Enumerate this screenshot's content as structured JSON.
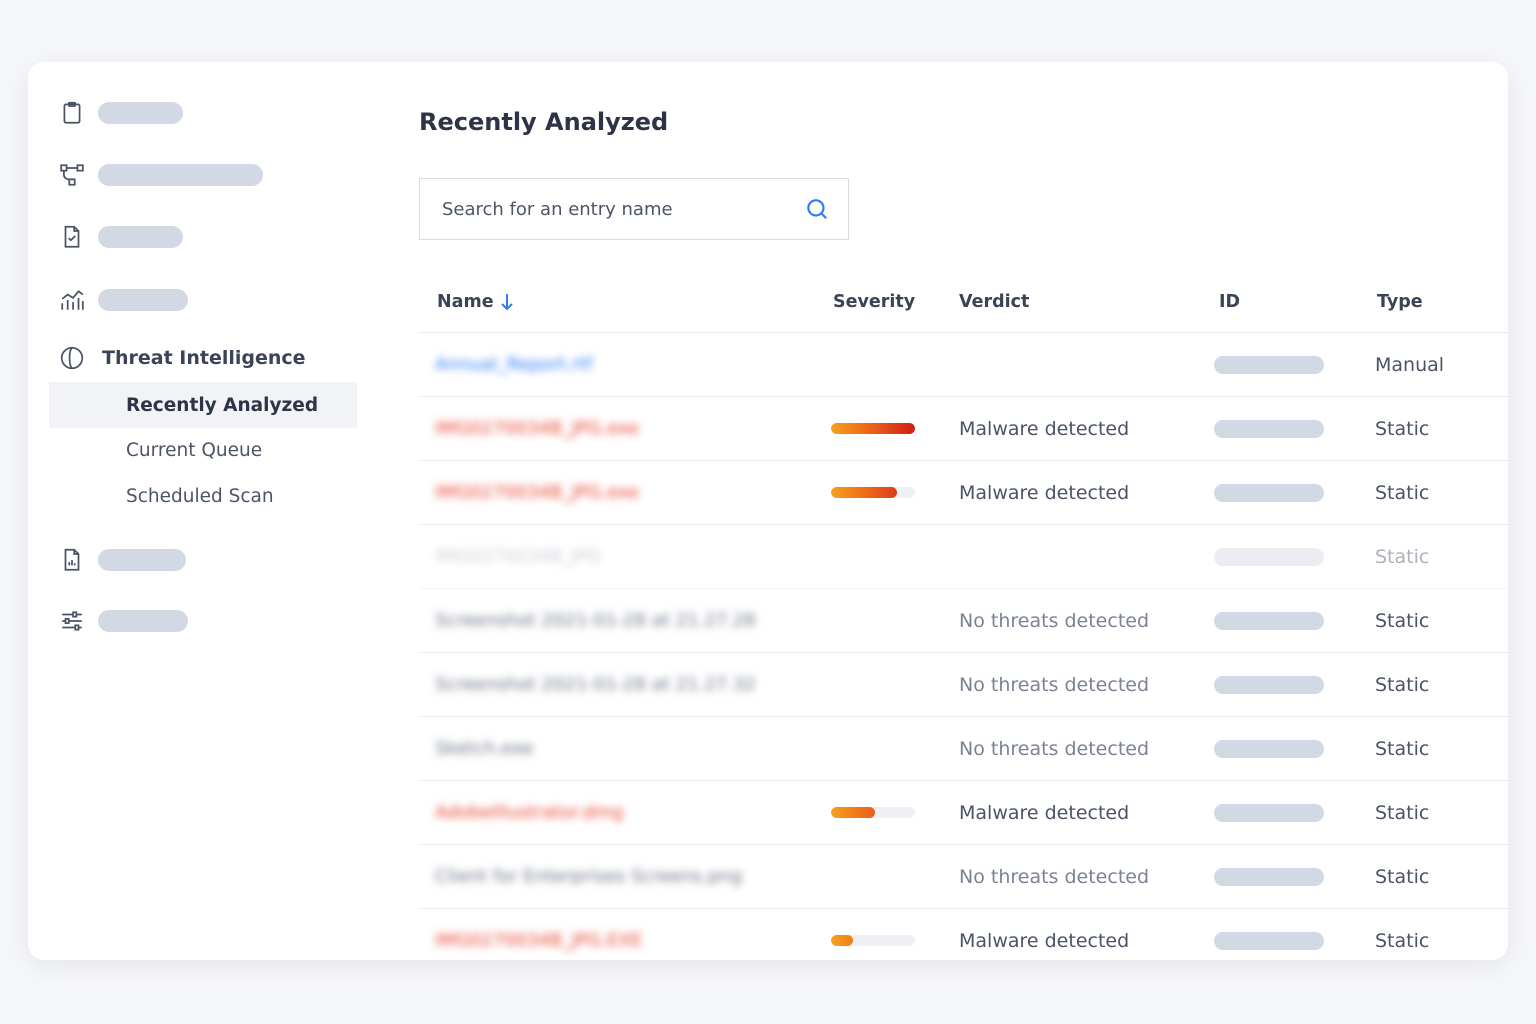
{
  "sidebar": {
    "items": [
      {
        "icon": "clipboard-icon"
      },
      {
        "icon": "workflow-icon"
      },
      {
        "icon": "file-check-icon"
      },
      {
        "icon": "analytics-icon"
      },
      {
        "icon": "threat-intelligence-icon",
        "label": "Threat Intelligence"
      },
      {
        "icon": "file-report-icon"
      },
      {
        "icon": "sliders-icon"
      }
    ],
    "subitems": [
      {
        "label": "Recently Analyzed",
        "active": true
      },
      {
        "label": "Current Queue"
      },
      {
        "label": "Scheduled Scan"
      }
    ]
  },
  "main": {
    "title": "Recently Analyzed",
    "search": {
      "placeholder": "Search for an entry name"
    },
    "columns": {
      "name": "Name",
      "severity": "Severity",
      "verdict": "Verdict",
      "id": "ID",
      "type": "Type"
    },
    "rows": [
      {
        "name": "Annual_Report.rtf",
        "severity": 0,
        "verdict": "",
        "type": "Manual",
        "name_color": "#2f7cf6"
      },
      {
        "name": "IMG0270034B_JPG.exe",
        "severity": 1.0,
        "verdict": "Malware detected",
        "type": "Static",
        "name_color": "#e6432f"
      },
      {
        "name": "IMG0270034B_JPG.exe",
        "severity": 0.78,
        "verdict": "Malware detected",
        "type": "Static",
        "name_color": "#e6432f"
      },
      {
        "name": "IMG0270034B_JPG",
        "severity": 0,
        "verdict": "",
        "type": "Static",
        "name_color": "#8a93a3",
        "faded": true
      },
      {
        "name": "Screenshot 2021-01-28 at 21.27.28",
        "severity": 0,
        "verdict": "No threats detected",
        "type": "Static",
        "name_color": "#6b7485"
      },
      {
        "name": "Screenshot 2021-01-28 at 21.27.32",
        "severity": 0,
        "verdict": "No threats detected",
        "type": "Static",
        "name_color": "#6b7485"
      },
      {
        "name": "Sketch.exe",
        "severity": 0,
        "verdict": "No threats detected",
        "type": "Static",
        "name_color": "#6b7485"
      },
      {
        "name": "AdobeIllustrator.dmg",
        "severity": 0.52,
        "verdict": "Malware detected",
        "type": "Static",
        "name_color": "#e6432f"
      },
      {
        "name": "Client for Enterprises Screens.png",
        "severity": 0,
        "verdict": "No threats detected",
        "type": "Static",
        "name_color": "#6b7485"
      },
      {
        "name": "IMG0270034B_JPG.EXE",
        "severity": 0.26,
        "verdict": "Malware detected",
        "type": "Static",
        "name_color": "#e6432f"
      }
    ]
  },
  "colors": {
    "accent": "#2f7cf6",
    "malware": "#e6432f",
    "severity_start": "#f5a021",
    "severity_end": "#d01c10"
  }
}
